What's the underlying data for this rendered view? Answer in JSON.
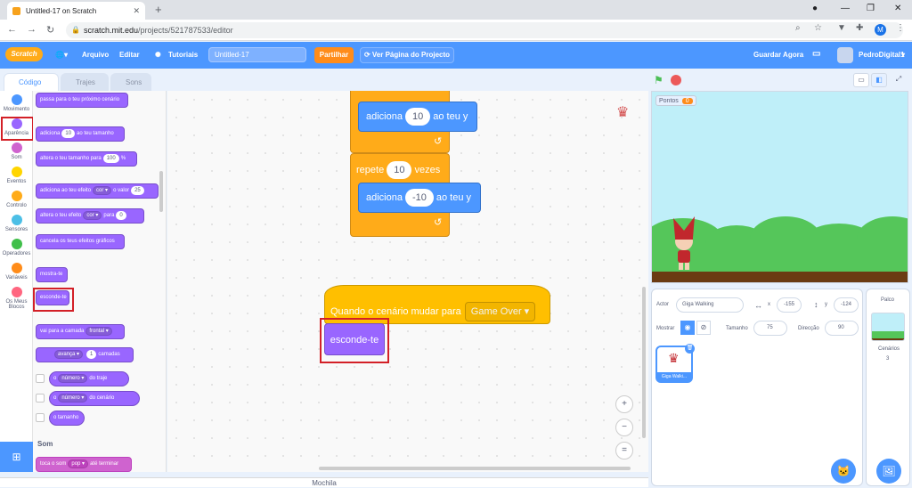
{
  "browser": {
    "tab_title": "Untitled-17 on Scratch",
    "new_tab": "+",
    "url_host": "scratch.mit.edu",
    "url_path": "/projects/521787533/editor",
    "profile_initial": "M"
  },
  "menu": {
    "logo": "Scratch",
    "language_icon": "globe-icon",
    "file": "Arquivo",
    "edit": "Editar",
    "tutorials": "Tutoriais",
    "project_title": "Untitled-17",
    "share": "Partilhar",
    "see_project": "Ver Página do Projecto",
    "save_now": "Guardar Agora",
    "username": "PedroDigital1"
  },
  "tabs": {
    "code": "Código",
    "costumes": "Trajes",
    "sounds": "Sons"
  },
  "categories": [
    {
      "label": "Movimento",
      "color": "#4c97ff"
    },
    {
      "label": "Aparência",
      "color": "#9966ff"
    },
    {
      "label": "Som",
      "color": "#cf63cf"
    },
    {
      "label": "Eventos",
      "color": "#ffd500"
    },
    {
      "label": "Controlo",
      "color": "#ffab19"
    },
    {
      "label": "Sensores",
      "color": "#4cbfe6"
    },
    {
      "label": "Operadores",
      "color": "#40bf4a"
    },
    {
      "label": "Variáveis",
      "color": "#ff8c1a"
    },
    {
      "label": "Os Meus Blocos",
      "color": "#ff6680"
    }
  ],
  "palette": {
    "next_backdrop": "passa para o teu próximo cenário",
    "change_size": "adiciona",
    "change_size_val": "10",
    "change_size_suffix": "ao teu tamanho",
    "set_size": "altera o teu tamanho para",
    "set_size_val": "100",
    "set_size_suffix": "%",
    "change_effect": "adiciona ao teu efeito",
    "change_effect_dd": "cor",
    "change_effect_mid": "o valor",
    "change_effect_val": "25",
    "set_effect": "altera o teu efeito",
    "set_effect_dd": "cor",
    "set_effect_mid": "para",
    "set_effect_val": "0",
    "clear_effects": "cancela os teus efeitos gráficos",
    "show": "mostra-te",
    "hide": "esconde-te",
    "go_layer": "vai para a camada",
    "go_layer_dd": "frontal",
    "go_forward_dd": "avança",
    "go_forward_val": "1",
    "go_forward_suffix": "camadas",
    "costume_number_a": "o",
    "costume_number_dd": "número",
    "costume_number_suffix": "do traje",
    "backdrop_number_a": "o",
    "backdrop_number_dd": "número",
    "backdrop_number_suffix": "do cenário",
    "size_reporter": "o tamanho",
    "sound_header": "Som",
    "play_sound": "toca o som",
    "play_sound_dd": "pop",
    "play_sound_suffix": "até terminar"
  },
  "workspace": {
    "change_y1": "adiciona",
    "change_y1_val": "10",
    "change_y1_suffix": "ao teu y",
    "repeat": "repete",
    "repeat_val": "10",
    "repeat_suffix": "vezes",
    "change_y2": "adiciona",
    "change_y2_val": "-10",
    "change_y2_suffix": "ao teu y",
    "hat": "Quando o cenário mudar para",
    "hat_dd": "Game Over",
    "hide": "esconde-te",
    "zoom_in": "+",
    "zoom_out": "−",
    "zoom_reset": "="
  },
  "backpack": "Mochila",
  "stage": {
    "monitor_label": "Pontos",
    "monitor_value": "0"
  },
  "sprite_info": {
    "sprite_label": "Actor",
    "sprite_name": "Giga Walking",
    "x_label": "x",
    "x_value": "-155",
    "y_label": "y",
    "y_value": "-124",
    "show_label": "Mostrar",
    "size_label": "Tamanho",
    "size_value": "75",
    "direction_label": "Direcção",
    "direction_value": "90",
    "thumb_name": "Giga Walki..."
  },
  "stage_panel": {
    "title": "Palco",
    "backdrops_label": "Cenários",
    "backdrops_count": "3"
  }
}
